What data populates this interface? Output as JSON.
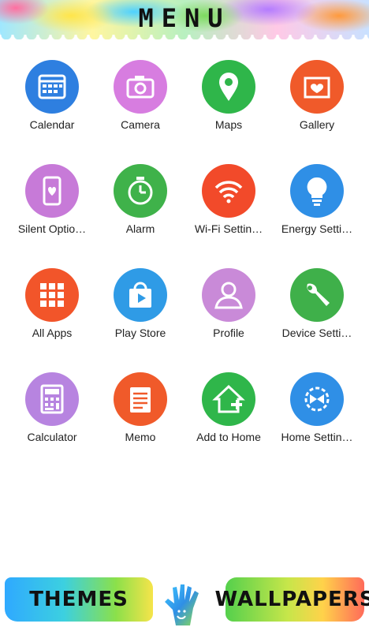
{
  "header": {
    "title": "MENU"
  },
  "apps": [
    {
      "label": "Calendar",
      "icon": "calendar-icon",
      "color": "#2e7fe0"
    },
    {
      "label": "Camera",
      "icon": "camera-icon",
      "color": "#d77de0"
    },
    {
      "label": "Maps",
      "icon": "map-pin-icon",
      "color": "#2fb64a"
    },
    {
      "label": "Gallery",
      "icon": "picture-frame-icon",
      "color": "#f05a2a"
    },
    {
      "label": "Silent Optio…",
      "icon": "phone-heart-icon",
      "color": "#c77ad8"
    },
    {
      "label": "Alarm",
      "icon": "alarm-clock-icon",
      "color": "#3fb24a"
    },
    {
      "label": "Wi-Fi Settin…",
      "icon": "wifi-icon",
      "color": "#f24a2a"
    },
    {
      "label": "Energy Setti…",
      "icon": "lightbulb-icon",
      "color": "#2f8fe6"
    },
    {
      "label": "All Apps",
      "icon": "grid-icon",
      "color": "#f2552a"
    },
    {
      "label": "Play Store",
      "icon": "shopping-bag-play-icon",
      "color": "#2f9be6"
    },
    {
      "label": "Profile",
      "icon": "user-icon",
      "color": "#c98ad8"
    },
    {
      "label": "Device Setti…",
      "icon": "wrench-icon",
      "color": "#3fb04a"
    },
    {
      "label": "Calculator",
      "icon": "calculator-icon",
      "color": "#b784e0"
    },
    {
      "label": "Memo",
      "icon": "notepad-icon",
      "color": "#f05a2a"
    },
    {
      "label": "Add to Home",
      "icon": "home-plus-icon",
      "color": "#2fb64a"
    },
    {
      "label": "Home Settin…",
      "icon": "home-settings-icon",
      "color": "#2f8fe6"
    }
  ],
  "footer": {
    "themes_label": "THEMES",
    "wallpapers_label": "WALLPAPERS",
    "hand_icon": "painted-hand-icon"
  }
}
